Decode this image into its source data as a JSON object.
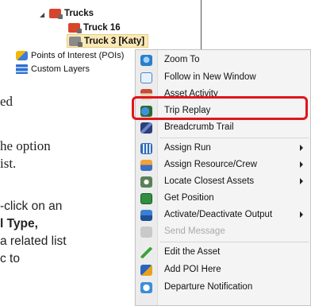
{
  "tree": {
    "expand_glyph": "◢",
    "items": [
      {
        "label": "Trucks",
        "icon": "truck-group-icon"
      },
      {
        "label": "Truck 16",
        "icon": "truck-icon"
      },
      {
        "label": "Truck 3 [Katy]",
        "icon": "truck-icon"
      },
      {
        "label": "Points of Interest (POIs)",
        "icon": "poi-icon"
      },
      {
        "label": "Custom Layers",
        "icon": "layers-icon"
      }
    ]
  },
  "document": {
    "lines": [
      "ed",
      "he option",
      "ist.",
      "-click on an",
      "l Type,",
      "a related list",
      "c to"
    ]
  },
  "menu": {
    "items": [
      {
        "label": "Zoom To",
        "icon": "zoom-icon"
      },
      {
        "label": "Follow in New Window",
        "icon": "window-icon"
      },
      {
        "label": "Asset Activity",
        "icon": "activity-icon"
      },
      {
        "label": "Trip Replay",
        "icon": "trip-replay-icon",
        "highlighted": true
      },
      {
        "label": "Breadcrumb Trail",
        "icon": "breadcrumb-icon"
      },
      {
        "label": "Assign Run",
        "icon": "run-icon",
        "submenu": true
      },
      {
        "label": "Assign Resource/Crew",
        "icon": "crew-icon",
        "submenu": true
      },
      {
        "label": "Locate Closest Assets",
        "icon": "locate-icon",
        "submenu": true
      },
      {
        "label": "Get Position",
        "icon": "position-icon"
      },
      {
        "label": "Activate/Deactivate Output",
        "icon": "output-icon",
        "submenu": true
      },
      {
        "label": "Send Message",
        "icon": "message-icon",
        "disabled": true
      },
      {
        "label": "Edit the Asset",
        "icon": "edit-icon"
      },
      {
        "label": "Add POI Here",
        "icon": "add-poi-icon"
      },
      {
        "label": "Departure Notification",
        "icon": "departure-icon"
      }
    ],
    "highlight_color": "#e0151e"
  }
}
